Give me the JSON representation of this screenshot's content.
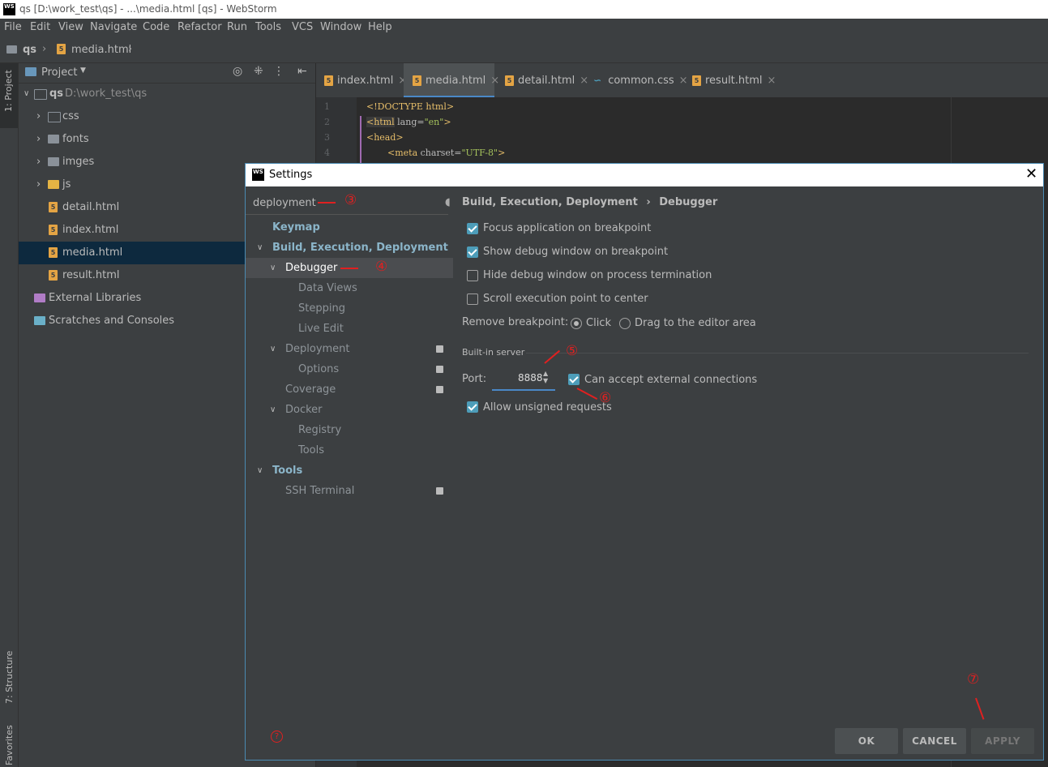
{
  "window": {
    "title": "qs [D:\\work_test\\qs] - ...\\media.html [qs] - WebStorm",
    "logo": "WS"
  },
  "menu": [
    "File",
    "Edit",
    "View",
    "Navigate",
    "Code",
    "Refactor",
    "Run",
    "Tools",
    "VCS",
    "Window",
    "Help"
  ],
  "breadcrumb": {
    "project": "qs",
    "file": "media.html"
  },
  "left_strip": {
    "project_tab": "1: Project",
    "structure_tab": "7: Structure",
    "favorites_tab": "Favorites"
  },
  "project_panel": {
    "header": "Project",
    "root": {
      "name": "qs",
      "path": "D:\\work_test\\qs"
    },
    "items": [
      "css",
      "fonts",
      "imges",
      "js",
      "detail.html",
      "index.html",
      "media.html",
      "result.html"
    ],
    "external": "External Libraries",
    "scratches": "Scratches and Consoles"
  },
  "tabs": [
    "index.html",
    "media.html",
    "detail.html",
    "common.css",
    "result.html"
  ],
  "code": {
    "lines": [
      "1",
      "2",
      "3",
      "4"
    ],
    "l1": "<!DOCTYPE html>",
    "l2_tag": "<html",
    "l2_attr": " lang=",
    "l2_val": "\"en\"",
    "l2_end": ">",
    "l3": "<head>",
    "l4_tag": "<meta",
    "l4_attr": " charset=",
    "l4_val": "\"UTF-8\"",
    "l4_end": ">"
  },
  "dialog": {
    "title": "Settings",
    "logo": "WS",
    "search_value": "deployment",
    "tree": {
      "keymap": "Keymap",
      "build": "Build, Execution, Deployment",
      "debugger": "Debugger",
      "data_views": "Data Views",
      "stepping": "Stepping",
      "live_edit": "Live Edit",
      "deployment": "Deployment",
      "options": "Options",
      "coverage": "Coverage",
      "docker": "Docker",
      "registry": "Registry",
      "tools_sub": "Tools",
      "tools": "Tools",
      "ssh": "SSH Terminal"
    },
    "crumb": {
      "parent": "Build, Execution, Deployment",
      "sep": "›",
      "current": "Debugger"
    },
    "options": {
      "focus": "Focus application on breakpoint",
      "show_debug": "Show debug window on breakpoint",
      "hide_debug": "Hide debug window on process termination",
      "scroll": "Scroll execution point to center",
      "remove_bp_label": "Remove breakpoint:",
      "click": "Click",
      "drag": "Drag to the editor area",
      "builtin": "Built-in server",
      "port_label": "Port:",
      "port_value": "8888",
      "external": "Can accept external connections",
      "unsigned": "Allow unsigned requests"
    },
    "buttons": {
      "ok": "OK",
      "cancel": "CANCEL",
      "apply": "APPLY"
    },
    "help": "?"
  },
  "annotations": [
    "③",
    "④",
    "⑤",
    "⑥",
    "⑦"
  ],
  "colors": {
    "accent": "#4d9db9",
    "annotation": "#e02020",
    "html_icon": "#e4a444",
    "css_icon": "#4d9db9"
  }
}
